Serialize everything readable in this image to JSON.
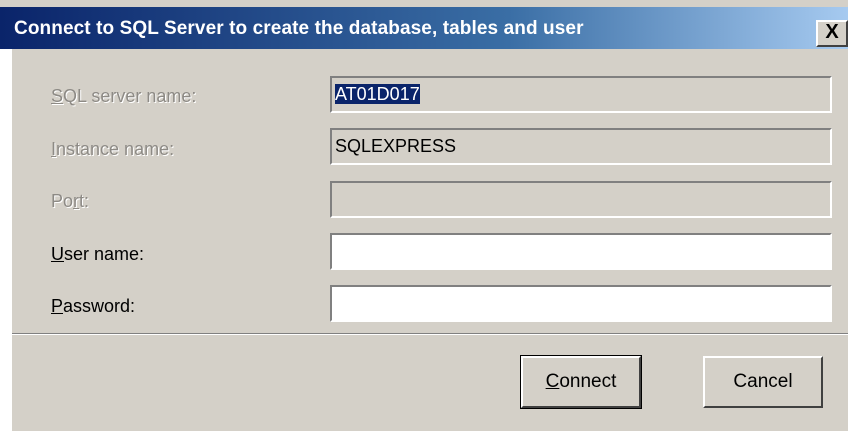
{
  "window": {
    "title": "Connect to SQL  Server to create the database, tables and user",
    "close_label": "X"
  },
  "form": {
    "server_label_mnemonic": "S",
    "server_label_rest": "QL server name:",
    "server_value": "AT01D017",
    "instance_label_mnemonic": "I",
    "instance_label_rest": "nstance name:",
    "instance_value": "SQLEXPRESS",
    "port_label_pre": "Po",
    "port_label_mnemonic": "r",
    "port_label_post": "t:",
    "port_value": "",
    "username_label_mnemonic": "U",
    "username_label_rest": "ser name:",
    "username_value": "",
    "password_label_mnemonic": "P",
    "password_label_rest": "assword:",
    "password_value": ""
  },
  "buttons": {
    "connect_mnemonic": "C",
    "connect_rest": "onnect",
    "cancel_label": "Cancel"
  }
}
